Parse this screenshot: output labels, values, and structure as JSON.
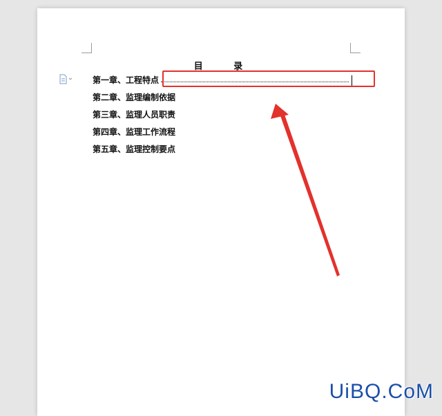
{
  "document": {
    "title": "目 录",
    "toc_items": [
      {
        "label": "第一章、工程特点"
      },
      {
        "label": "第二章、监理编制依据"
      },
      {
        "label": "第三章、监理人员职责"
      },
      {
        "label": "第四章、监理工作流程"
      },
      {
        "label": "第五章、监理控制要点"
      }
    ]
  },
  "annotation": {
    "highlight_color": "#e3312c",
    "arrow_color": "#e3312c"
  },
  "watermark": {
    "text": "UiBQ.CoM",
    "color": "#1b4fa8"
  }
}
